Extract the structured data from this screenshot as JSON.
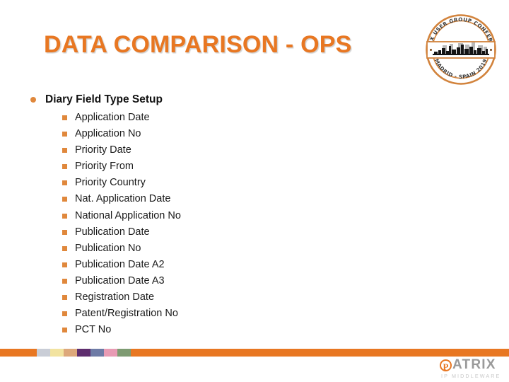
{
  "slide": {
    "title": "DATA COMPARISON - OPS",
    "title_color": "#E87722"
  },
  "seal": {
    "name": "conference-seal-logo",
    "arc_top_text": "PATRIX USER GROUP CONFERENCE",
    "arc_bottom_text": "MADRID - SPAIN 2019",
    "ring_color": "#D2833C",
    "skyline_color": "#1a1a1a"
  },
  "content": {
    "heading": "Diary Field Type Setup",
    "bullet_color": "#E0883C",
    "items": [
      "Application Date",
      "Application No",
      "Priority Date",
      "Priority From",
      "Priority Country",
      "Nat. Application Date",
      "National Application No",
      "Publication Date",
      "Publication No",
      "Publication Date A2",
      "Publication Date A3",
      "Registration Date",
      "Patent/Registration No",
      "PCT No"
    ]
  },
  "footer": {
    "bar_color": "#E87722",
    "swatch_colors": [
      "#C9CDD6",
      "#F2E3A0",
      "#DDA87B",
      "#5E2D6E",
      "#6E7BA6",
      "#E89BB4",
      "#7E9B72"
    ]
  },
  "brand": {
    "mark_letter": "P",
    "name": "ATRIX",
    "tagline": "IP MIDDLEWARE",
    "mark_color": "#E87722",
    "name_color": "#9a9a9a"
  }
}
